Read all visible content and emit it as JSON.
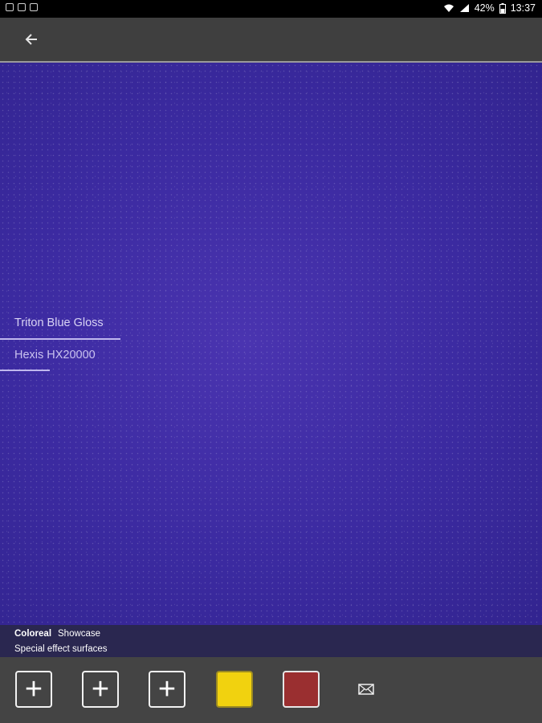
{
  "status_bar": {
    "battery_percent": "42%",
    "time": "13:37",
    "icons": [
      "image-icon",
      "card-icon",
      "book-icon",
      "wifi-icon",
      "signal-icon",
      "battery-icon"
    ]
  },
  "app_bar": {
    "back_icon": "arrow-left-icon"
  },
  "surface": {
    "color_name": "Triton Blue Gloss",
    "color_code": "Hexis HX20000",
    "color": "#3b2aa0"
  },
  "info": {
    "brand": "Coloreal",
    "section": "Showcase",
    "subtitle": "Special effect surfaces"
  },
  "toolbar": {
    "slots": [
      {
        "type": "add",
        "icon": "plus-icon"
      },
      {
        "type": "add",
        "icon": "plus-icon"
      },
      {
        "type": "add",
        "icon": "plus-icon"
      },
      {
        "type": "swatch",
        "color": "#f1d20f"
      },
      {
        "type": "swatch",
        "color": "#9a2f30"
      }
    ],
    "mail_icon": "mail-icon"
  }
}
